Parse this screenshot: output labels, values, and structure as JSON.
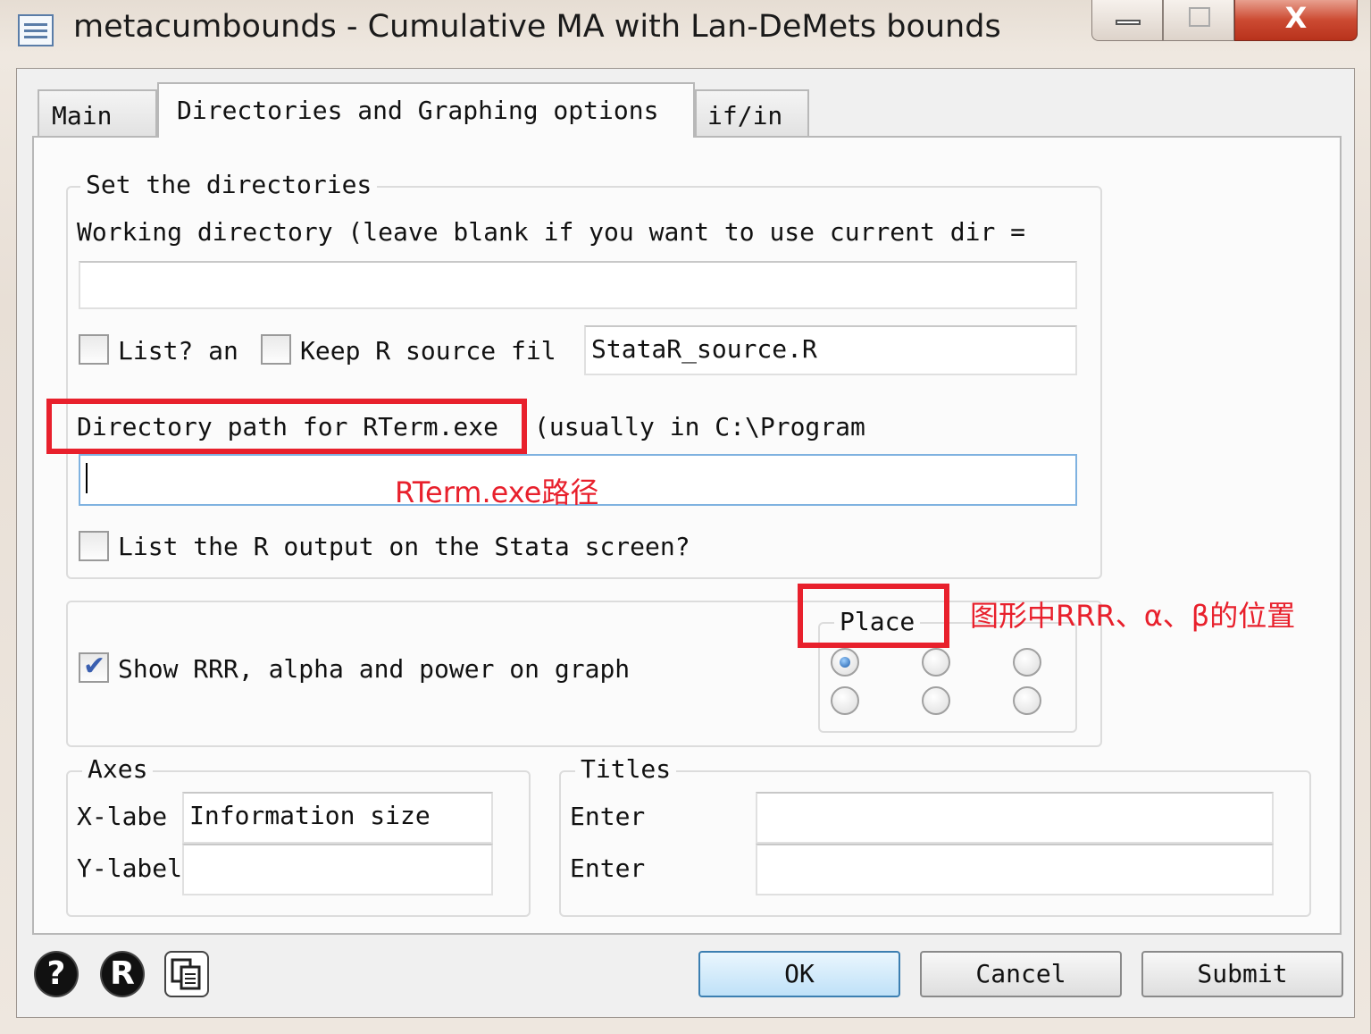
{
  "window": {
    "title": "metacumbounds - Cumulative MA with Lan-DeMets bounds",
    "minimize": "",
    "maximize": "",
    "close": "X"
  },
  "tabs": [
    {
      "label": "Main"
    },
    {
      "label": "Directories and Graphing options"
    },
    {
      "label": "if/in"
    }
  ],
  "directories": {
    "group_label": "Set the directories",
    "working_dir_label": "Working directory (leave blank if you want to use current dir =",
    "working_dir_value": "",
    "list_label": "List? an",
    "list_checked": false,
    "keep_label": "Keep R source fil",
    "keep_checked": false,
    "source_file_value": "StataR_source.R",
    "rterm_label": "Directory path for RTerm.exe",
    "rterm_label_cont": "(usually in C:\\Program",
    "rterm_value": "",
    "list_output_label": "List the R output on the Stata screen?",
    "list_output_checked": false
  },
  "graph": {
    "show_label": "Show RRR, alpha and power on graph",
    "show_checked": true,
    "place_label": "Place",
    "place_options": [
      true,
      false,
      false,
      false,
      false,
      false
    ]
  },
  "axes": {
    "group_label": "Axes",
    "xlabel_label": "X-labe",
    "xlabel_value": "Information size",
    "ylabel_label": "Y-label",
    "ylabel_value": ""
  },
  "titles": {
    "group_label": "Titles",
    "title1_label": "Enter",
    "title1_value": "",
    "title2_label": "Enter",
    "title2_value": ""
  },
  "annotations": {
    "rterm_note": "RTerm.exe路径",
    "place_note": "图形中RRR、α、β的位置",
    "color": "#e8202c"
  },
  "buttons": {
    "help_icon": "?",
    "info_icon": "R",
    "copy_icon": "copy-icon",
    "ok": "OK",
    "cancel": "Cancel",
    "submit": "Submit"
  }
}
